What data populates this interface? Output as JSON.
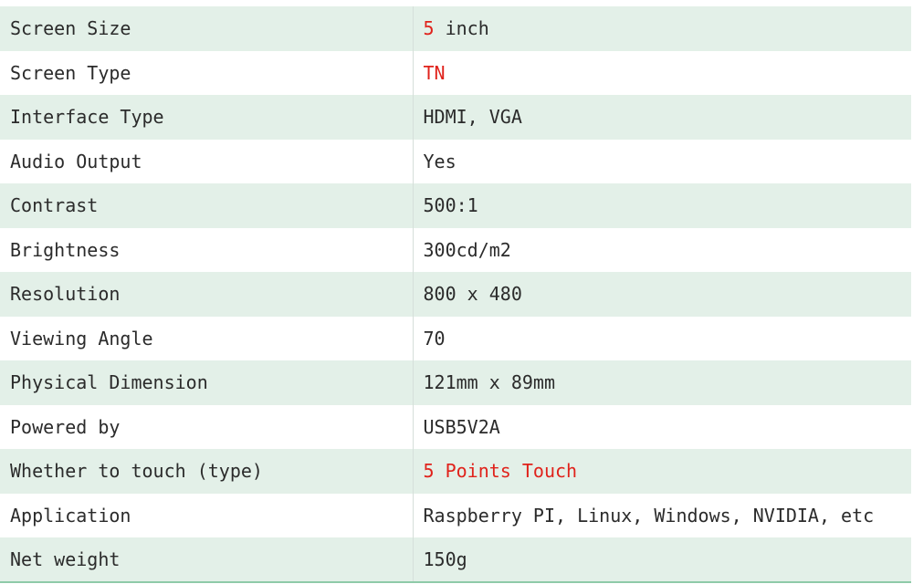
{
  "table": {
    "rows": [
      {
        "label": "Screen Size",
        "value_highlight": "5",
        "value": " inch"
      },
      {
        "label": "Screen Type",
        "value_highlight": "TN",
        "value": ""
      },
      {
        "label": "Interface Type",
        "value_highlight": "",
        "value": "HDMI, VGA"
      },
      {
        "label": "Audio Output",
        "value_highlight": "",
        "value": "Yes"
      },
      {
        "label": "Contrast",
        "value_highlight": "",
        "value": "500:1"
      },
      {
        "label": "Brightness",
        "value_highlight": "",
        "value": "300cd/m2"
      },
      {
        "label": "Resolution",
        "value_highlight": "",
        "value": "800 x 480"
      },
      {
        "label": "Viewing Angle",
        "value_highlight": "",
        "value": "70"
      },
      {
        "label": "Physical Dimension",
        "value_highlight": "",
        "value": "121mm x 89mm"
      },
      {
        "label": "Powered by",
        "value_highlight": "",
        "value": "USB5V2A"
      },
      {
        "label": "Whether to touch (type)",
        "value_highlight": "5 Points Touch",
        "value": ""
      },
      {
        "label": "Application",
        "value_highlight": "",
        "value": "Raspberry PI, Linux, Windows, NVIDIA, etc"
      },
      {
        "label": "Net weight",
        "value_highlight": "",
        "value": "150g"
      }
    ]
  },
  "colors": {
    "row_shade": "#e3f0e8",
    "highlight_text": "#e0221b",
    "body_text": "#2b2b2b"
  }
}
